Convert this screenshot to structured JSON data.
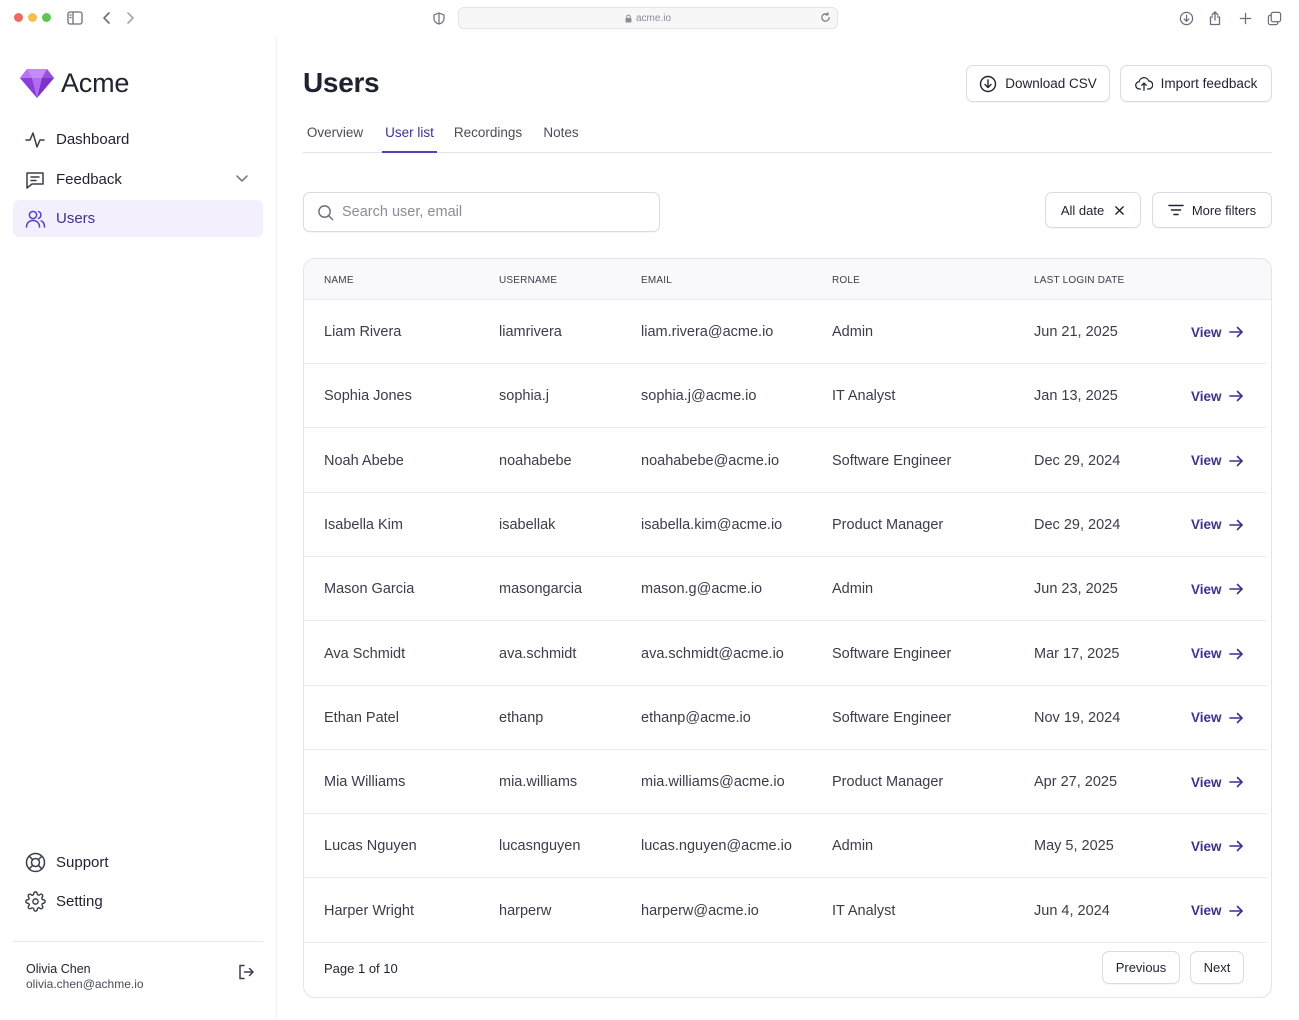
{
  "browser": {
    "url": "acme.io"
  },
  "brand": {
    "name": "Acme",
    "accent": "#5b3fbf"
  },
  "sidebar": {
    "items": [
      {
        "label": "Dashboard",
        "icon": "activity-icon"
      },
      {
        "label": "Feedback",
        "icon": "message-square-icon"
      },
      {
        "label": "Users",
        "icon": "users-icon",
        "active": true
      }
    ],
    "footer_items": [
      {
        "label": "Support",
        "icon": "lifebuoy-icon"
      },
      {
        "label": "Setting",
        "icon": "gear-icon"
      }
    ],
    "user": {
      "name": "Olivia Chen",
      "email": "olivia.chen@achme.io"
    }
  },
  "header": {
    "title": "Users",
    "download_label": "Download CSV",
    "import_label": "Import feedback"
  },
  "tabs": [
    {
      "label": "Overview"
    },
    {
      "label": "User list",
      "active": true
    },
    {
      "label": "Recordings"
    },
    {
      "label": "Notes"
    }
  ],
  "filters": {
    "search_placeholder": "Search user, email",
    "date_chip": "All date",
    "more_filters": "More filters"
  },
  "table": {
    "columns": [
      "NAME",
      "USERNAME",
      "EMAIL",
      "ROLE",
      "LAST LOGIN DATE"
    ],
    "action_label": "View",
    "rows": [
      {
        "name": "Liam Rivera",
        "username": "liamrivera",
        "email": "liam.rivera@acme.io",
        "role": "Admin",
        "last_login": "Jun 21, 2025"
      },
      {
        "name": "Sophia Jones",
        "username": "sophia.j",
        "email": "sophia.j@acme.io",
        "role": "IT Analyst",
        "last_login": "Jan 13, 2025"
      },
      {
        "name": "Noah Abebe",
        "username": "noahabebe",
        "email": "noahabebe@acme.io",
        "role": "Software Engineer",
        "last_login": "Dec 29, 2024"
      },
      {
        "name": "Isabella Kim",
        "username": "isabellak",
        "email": "isabella.kim@acme.io",
        "role": "Product Manager",
        "last_login": "Dec 29, 2024"
      },
      {
        "name": "Mason Garcia",
        "username": "masongarcia",
        "email": "mason.g@acme.io",
        "role": "Admin",
        "last_login": "Jun 23, 2025"
      },
      {
        "name": "Ava Schmidt",
        "username": "ava.schmidt",
        "email": "ava.schmidt@acme.io",
        "role": "Software Engineer",
        "last_login": "Mar 17, 2025"
      },
      {
        "name": "Ethan Patel",
        "username": "ethanp",
        "email": "ethanp@acme.io",
        "role": "Software Engineer",
        "last_login": "Nov 19, 2024"
      },
      {
        "name": "Mia Williams",
        "username": "mia.williams",
        "email": "mia.williams@acme.io",
        "role": "Product Manager",
        "last_login": "Apr 27, 2025"
      },
      {
        "name": "Lucas Nguyen",
        "username": "lucasnguyen",
        "email": "lucas.nguyen@acme.io",
        "role": "Admin",
        "last_login": "May 5, 2025"
      },
      {
        "name": "Harper Wright",
        "username": "harperw",
        "email": "harperw@acme.io",
        "role": "IT Analyst",
        "last_login": "Jun 4, 2024"
      }
    ]
  },
  "pagination": {
    "info": "Page 1 of 10",
    "previous_label": "Previous",
    "next_label": "Next"
  }
}
